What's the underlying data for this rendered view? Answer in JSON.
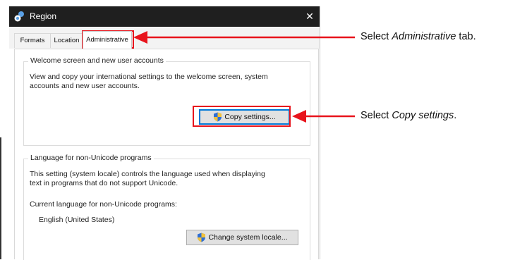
{
  "window": {
    "title": "Region",
    "close_glyph": "✕",
    "title_icon": "globe-icon"
  },
  "tabs": [
    {
      "label": "Formats",
      "active": false
    },
    {
      "label": "Location",
      "active": false
    },
    {
      "label": "Administrative",
      "active": true
    }
  ],
  "welcome_group": {
    "legend": "Welcome screen and new user accounts",
    "description_line1": "View and copy your international settings to the welcome screen, system",
    "description_line2": "accounts and new user accounts.",
    "button_label": "Copy settings...",
    "button_icon": "uac-shield-icon"
  },
  "language_group": {
    "legend": "Language for non-Unicode programs",
    "description_line1": "This setting (system locale) controls the language used when displaying",
    "description_line2": "text in programs that do not support Unicode.",
    "current_label": "Current language for non-Unicode programs:",
    "current_value": "English (United States)",
    "button_label": "Change system locale...",
    "button_icon": "uac-shield-icon"
  },
  "annotations": {
    "tab_instruction": {
      "prefix": "Select ",
      "emphasis": "Administrative",
      "suffix": " tab."
    },
    "button_instruction": {
      "prefix": "Select ",
      "emphasis": "Copy settings",
      "suffix": "."
    },
    "color": "#e8141c"
  }
}
